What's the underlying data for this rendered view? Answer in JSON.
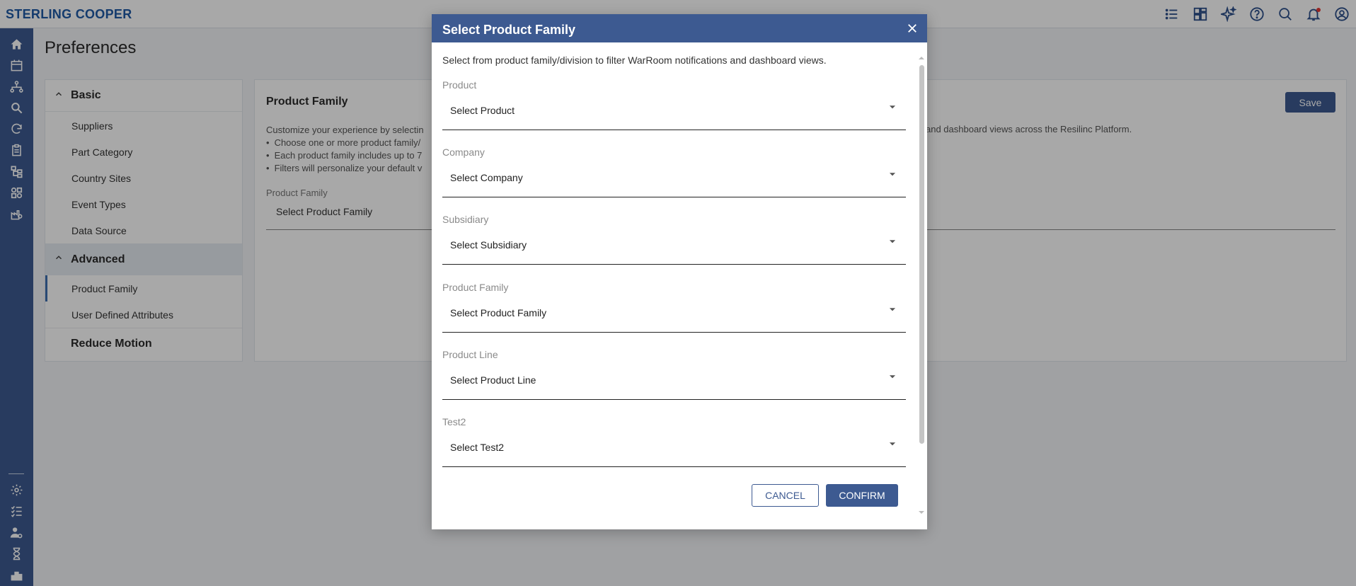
{
  "brand": "STERLING COOPER",
  "topbar": {
    "icons": [
      "list-icon",
      "dashboard-icon",
      "sparkle-icon",
      "help-icon",
      "search-icon",
      "bell-icon",
      "account-icon"
    ]
  },
  "leftnav": {
    "icons": [
      "home-icon",
      "calendar-icon",
      "network-icon",
      "search-zoom-icon",
      "refresh-icon",
      "clipboard-icon",
      "hierarchy-icon",
      "grid-icon",
      "factory-settings-icon",
      "settings-icon",
      "checklist-icon",
      "user-settings-icon",
      "hourglass-icon",
      "building-icon"
    ]
  },
  "page": {
    "title": "Preferences"
  },
  "settings": {
    "basic": {
      "label": "Basic",
      "items": [
        "Suppliers",
        "Part Category",
        "Country Sites",
        "Event Types",
        "Data Source"
      ]
    },
    "advanced": {
      "label": "Advanced",
      "items": [
        "Product Family",
        "User Defined Attributes"
      ],
      "active": "Product Family"
    },
    "reduce_motion": "Reduce Motion"
  },
  "content": {
    "title": "Product Family",
    "desc_left": "Customize your experience by selectin",
    "desc_right": "and dashboard views across the Resilinc Platform.",
    "bullets": [
      "Choose one or more product family/",
      "Each product family includes up to 7",
      "Filters will personalize your default v"
    ],
    "field_label": "Product Family",
    "field_value": "Select Product Family",
    "save_label": "Save"
  },
  "dialog": {
    "title": "Select Product Family",
    "intro": "Select from product family/division to filter WarRoom notifications and dashboard views.",
    "fields": [
      {
        "label": "Product",
        "value": "Select Product"
      },
      {
        "label": "Company",
        "value": "Select Company"
      },
      {
        "label": "Subsidiary",
        "value": "Select Subsidiary"
      },
      {
        "label": "Product Family",
        "value": "Select Product Family"
      },
      {
        "label": "Product Line",
        "value": "Select Product Line"
      },
      {
        "label": "Test2",
        "value": "Select Test2"
      }
    ],
    "cancel_label": "CANCEL",
    "confirm_label": "CONFIRM"
  },
  "colors": {
    "brand": "#1f5aa6",
    "nav": "#3d5a91",
    "accent": "#3d5a91",
    "notification_dot": "#e53935"
  }
}
